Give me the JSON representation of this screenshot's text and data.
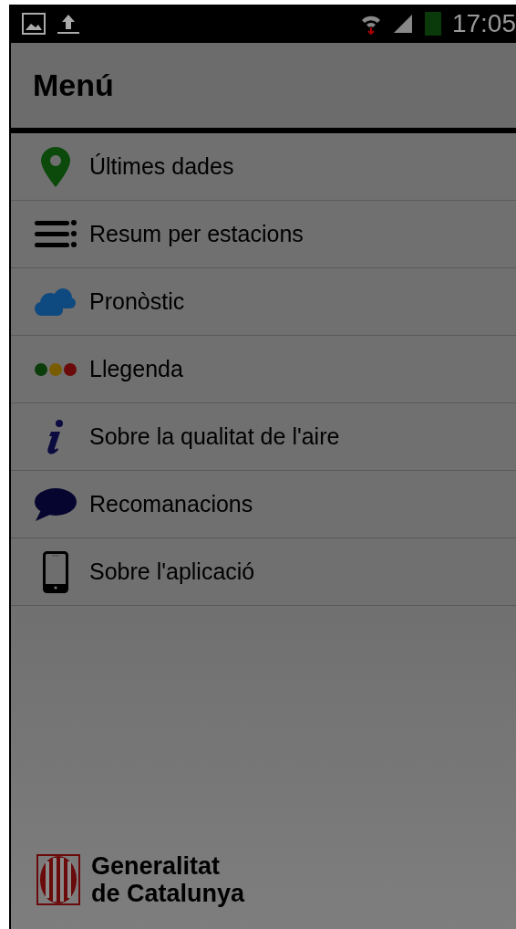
{
  "status_bar": {
    "time": "17:05"
  },
  "header": {
    "title": "Menú"
  },
  "menu": [
    {
      "label": "Últimes dades",
      "kind": "pin"
    },
    {
      "label": "Resum per estacions",
      "kind": "list"
    },
    {
      "label": "Pronòstic",
      "kind": "cloud"
    },
    {
      "label": "Llegenda",
      "kind": "dots"
    },
    {
      "label": "Sobre la qualitat de l'aire",
      "kind": "info"
    },
    {
      "label": "Recomanacions",
      "kind": "speech"
    },
    {
      "label": "Sobre l'aplicació",
      "kind": "phone"
    }
  ],
  "footer": {
    "logo_lines": [
      "Generalitat",
      "de Catalunya"
    ]
  }
}
